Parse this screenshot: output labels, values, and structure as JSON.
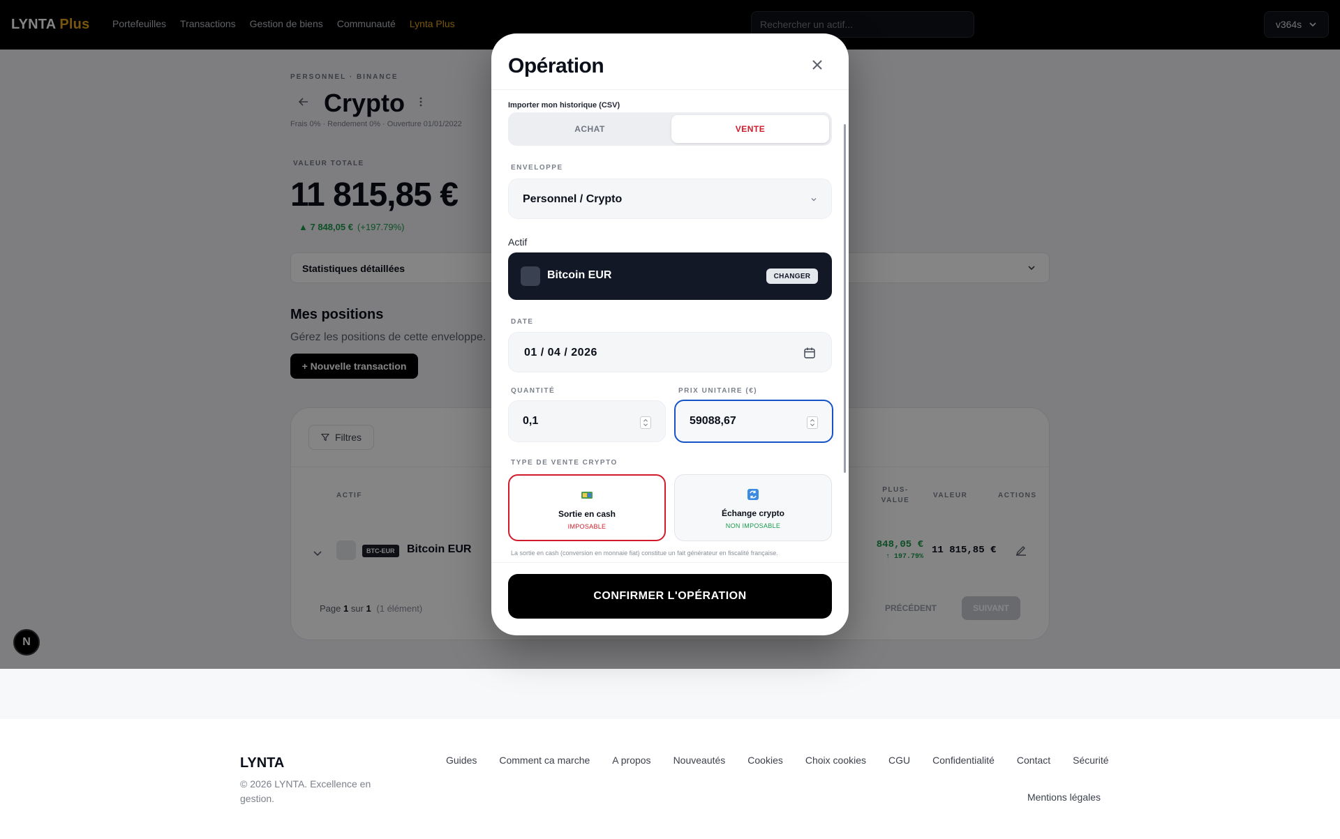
{
  "navbar": {
    "logo_main": "LYNTA",
    "logo_plus": "Plus",
    "links": [
      "Portefeuilles",
      "Transactions",
      "Gestion de biens",
      "Communauté",
      "Lynta Plus"
    ],
    "search_placeholder": "Rechercher un actif...",
    "account_label": "v364s",
    "accent_color": "#e6a817"
  },
  "page": {
    "breadcrumb": "PERSONNEL · BINANCE",
    "title": "Crypto",
    "subline": "Frais 0% · Rendement 0% · Ouverture 01/01/2022",
    "total_label": "VALEUR TOTALE",
    "total_value": "11 815,85 €",
    "gain_value": "▲ 7 848,05 €",
    "gain_pct": "(+197.79%)",
    "stats_label": "Statistiques détaillées",
    "positions_title": "Mes positions",
    "positions_sub": "Gérez les positions de cette enveloppe.",
    "new_tx_label": "+ Nouvelle transaction"
  },
  "table": {
    "filters_label": "Filtres",
    "headers": {
      "actif": "ACTIF",
      "plus_value_1": "PLUS-",
      "plus_value_2": "VALUE",
      "valeur": "VALEUR",
      "actions": "ACTIONS"
    },
    "row": {
      "ticker": "BTC-EUR",
      "name": "Bitcoin EUR",
      "plus_value": "848,05 €",
      "plus_value_pct": "↑ 197.79%",
      "value": "11 815,85 €"
    },
    "pager": {
      "prefix": "Page",
      "current": "1",
      "of": "sur",
      "total": "1",
      "count": "(1 élément)"
    },
    "prev_label": "PRÉCÉDENT",
    "next_label": "SUIVANT"
  },
  "dev_badge": "N",
  "modal": {
    "title": "Opération",
    "csv_link": "Importer mon historique (CSV)",
    "tab_achat": "ACHAT",
    "tab_vente": "VENTE",
    "envelope_label": "ENVELOPPE",
    "envelope_value": "Personnel / Crypto",
    "actif_label": "Actif",
    "asset_name": "Bitcoin EUR",
    "change_label": "CHANGER",
    "date_label": "DATE",
    "date_value": "01 / 04 / 2026",
    "qty_label": "QUANTITÉ",
    "qty_value": "0,1",
    "price_label": "PRIX UNITAIRE (€)",
    "price_value": "59088,67",
    "sale_type_label": "TYPE DE VENTE CRYPTO",
    "option_cash_title": "Sortie en cash",
    "option_cash_tag": "IMPOSABLE",
    "option_crypto_title": "Échange crypto",
    "option_crypto_tag": "NON IMPOSABLE",
    "note": "La sortie en cash (conversion en monnaie fiat) constitue un fait générateur en fiscalité française.",
    "confirm_label": "CONFIRMER L'OPÉRATION",
    "sell_color": "#d11a2a",
    "focus_color": "#1653c9"
  },
  "footer": {
    "logo": "LYNTA",
    "copyright": "© 2026 LYNTA. Excellence en gestion.",
    "links": [
      "Guides",
      "Comment ca marche",
      "A propos",
      "Nouveautés",
      "Cookies",
      "Choix cookies",
      "CGU",
      "Confidentialité",
      "Contact",
      "Sécurité"
    ],
    "legal": "Mentions légales"
  }
}
